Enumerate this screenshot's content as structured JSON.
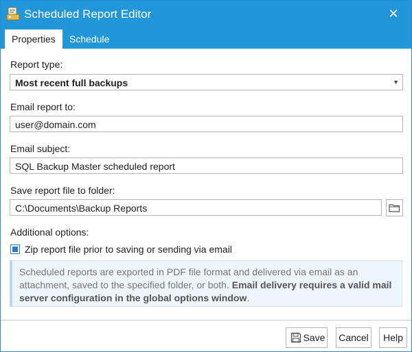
{
  "window": {
    "title": "Scheduled Report Editor",
    "close_glyph": "✕"
  },
  "tabs": [
    {
      "label": "Properties",
      "active": true
    },
    {
      "label": "Schedule",
      "active": false
    }
  ],
  "form": {
    "report_type_label": "Report type:",
    "report_type_value": "Most recent full backups",
    "email_to_label": "Email report to:",
    "email_to_value": "user@domain.com",
    "email_subject_label": "Email subject:",
    "email_subject_value": "SQL Backup Master scheduled report",
    "folder_label": "Save report file to folder:",
    "folder_value": "C:\\Documents\\Backup Reports",
    "additional_label": "Additional options:",
    "zip_label": "Zip report file prior to saving or sending via email",
    "zip_checked": true
  },
  "info": {
    "text_normal": "Scheduled reports are exported in PDF file format and delivered via email as an attachment, saved to the specified folder, or both. ",
    "text_bold": "Email delivery requires a valid mail server configuration in the global options window",
    "text_end": "."
  },
  "buttons": {
    "save": "Save",
    "cancel": "Cancel",
    "help": "Help"
  },
  "icons": {
    "app": "report-app-icon",
    "browse": "folder-icon",
    "save": "floppy-disk-icon",
    "dropdown": "chevron-down-icon"
  },
  "colors": {
    "titlebar": "#2196d9",
    "checkbox": "#2b79c2",
    "info_bg": "#eef5fb"
  }
}
